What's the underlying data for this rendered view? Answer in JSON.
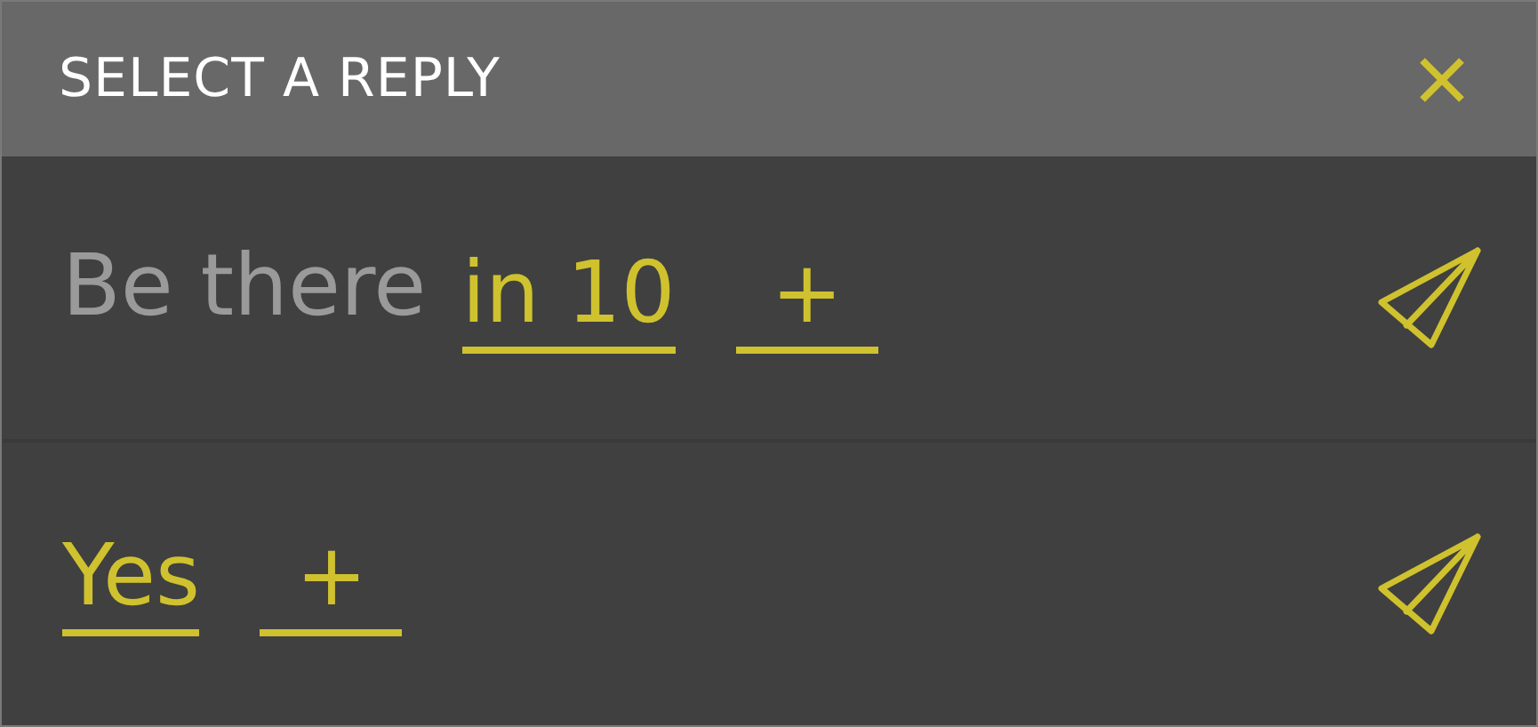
{
  "title": "SELECT A REPLY",
  "replies": [
    {
      "parts": [
        {
          "kind": "text",
          "text": "Be there"
        },
        {
          "kind": "choice",
          "text": "in 10"
        },
        {
          "kind": "add",
          "text": "+"
        }
      ]
    },
    {
      "parts": [
        {
          "kind": "choice",
          "text": "Yes"
        },
        {
          "kind": "add",
          "text": "+"
        }
      ]
    }
  ]
}
